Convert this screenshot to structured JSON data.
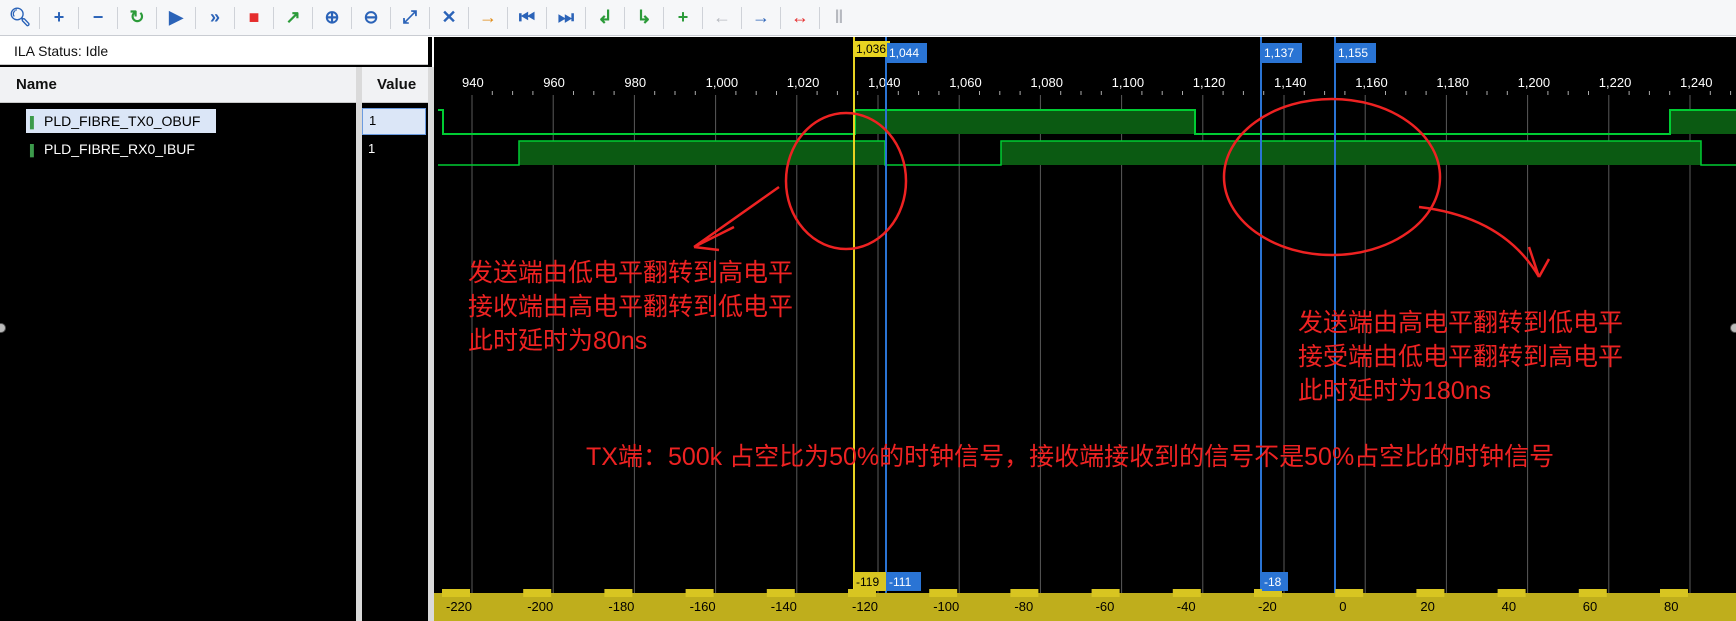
{
  "toolbar": {
    "icons": [
      "search-icon",
      "zoom-add-icon",
      "remove-icon",
      "refresh-icon",
      "run-icon",
      "run-fast-icon",
      "stop-icon",
      "export-icon",
      "zoom-in-icon",
      "zoom-out-icon",
      "zoom-fit-icon",
      "cursor-icon",
      "go-to-cursor-icon",
      "first-icon",
      "last-icon",
      "prev-transition-icon",
      "next-transition-icon",
      "add-marker-icon",
      "prev-marker-icon",
      "next-marker-icon",
      "swap-cursor-icon",
      "marker-disabled-icon"
    ]
  },
  "ila_status": "ILA Status: Idle",
  "columns": {
    "name": "Name",
    "value": "Value"
  },
  "signals": [
    {
      "name": "PLD_FIBRE_TX0_OBUF",
      "value": "1"
    },
    {
      "name": "PLD_FIBRE_RX0_IBUF",
      "value": "1"
    }
  ],
  "timeline": {
    "ticks": [
      "940",
      "960",
      "980",
      "1,000",
      "1,020",
      "1,040",
      "1,060",
      "1,080",
      "1,100",
      "1,120",
      "1,140",
      "1,160",
      "1,180",
      "1,200",
      "1,220",
      "1,240"
    ],
    "cursors": [
      {
        "label": "1,036",
        "color": "#e8d321"
      },
      {
        "label": "1,044",
        "color": "#2a74d4"
      },
      {
        "label": "1,137",
        "color": "#2a74d4"
      },
      {
        "label": "1,155",
        "color": "#2a74d4"
      }
    ],
    "bottom_ticks": [
      "-220",
      "-200",
      "-180",
      "-160",
      "-140",
      "-120",
      "-100",
      "-80",
      "-60",
      "-40",
      "-20",
      "0",
      "20",
      "40",
      "60",
      "80"
    ],
    "bottom_markers": [
      "-119",
      "-111",
      "-18"
    ]
  },
  "annotations": {
    "left": "发送端由低电平翻转到高电平\n接收端由高电平翻转到低电平\n此时延时为80ns",
    "right": "发送端由高电平翻转到低电平\n接受端由低电平翻转到高电平\n此时延时为180ns",
    "bottom": "TX端：500k 占空比为50%的时钟信号，接收端接收到的信号不是50%占空比的时钟信号"
  },
  "colors": {
    "signal_green": "#00cc33",
    "fill_green": "#0b5a12",
    "cursor_yellow": "#e8d321",
    "cursor_blue": "#2a74d4",
    "annotation_red": "#ee2222"
  }
}
